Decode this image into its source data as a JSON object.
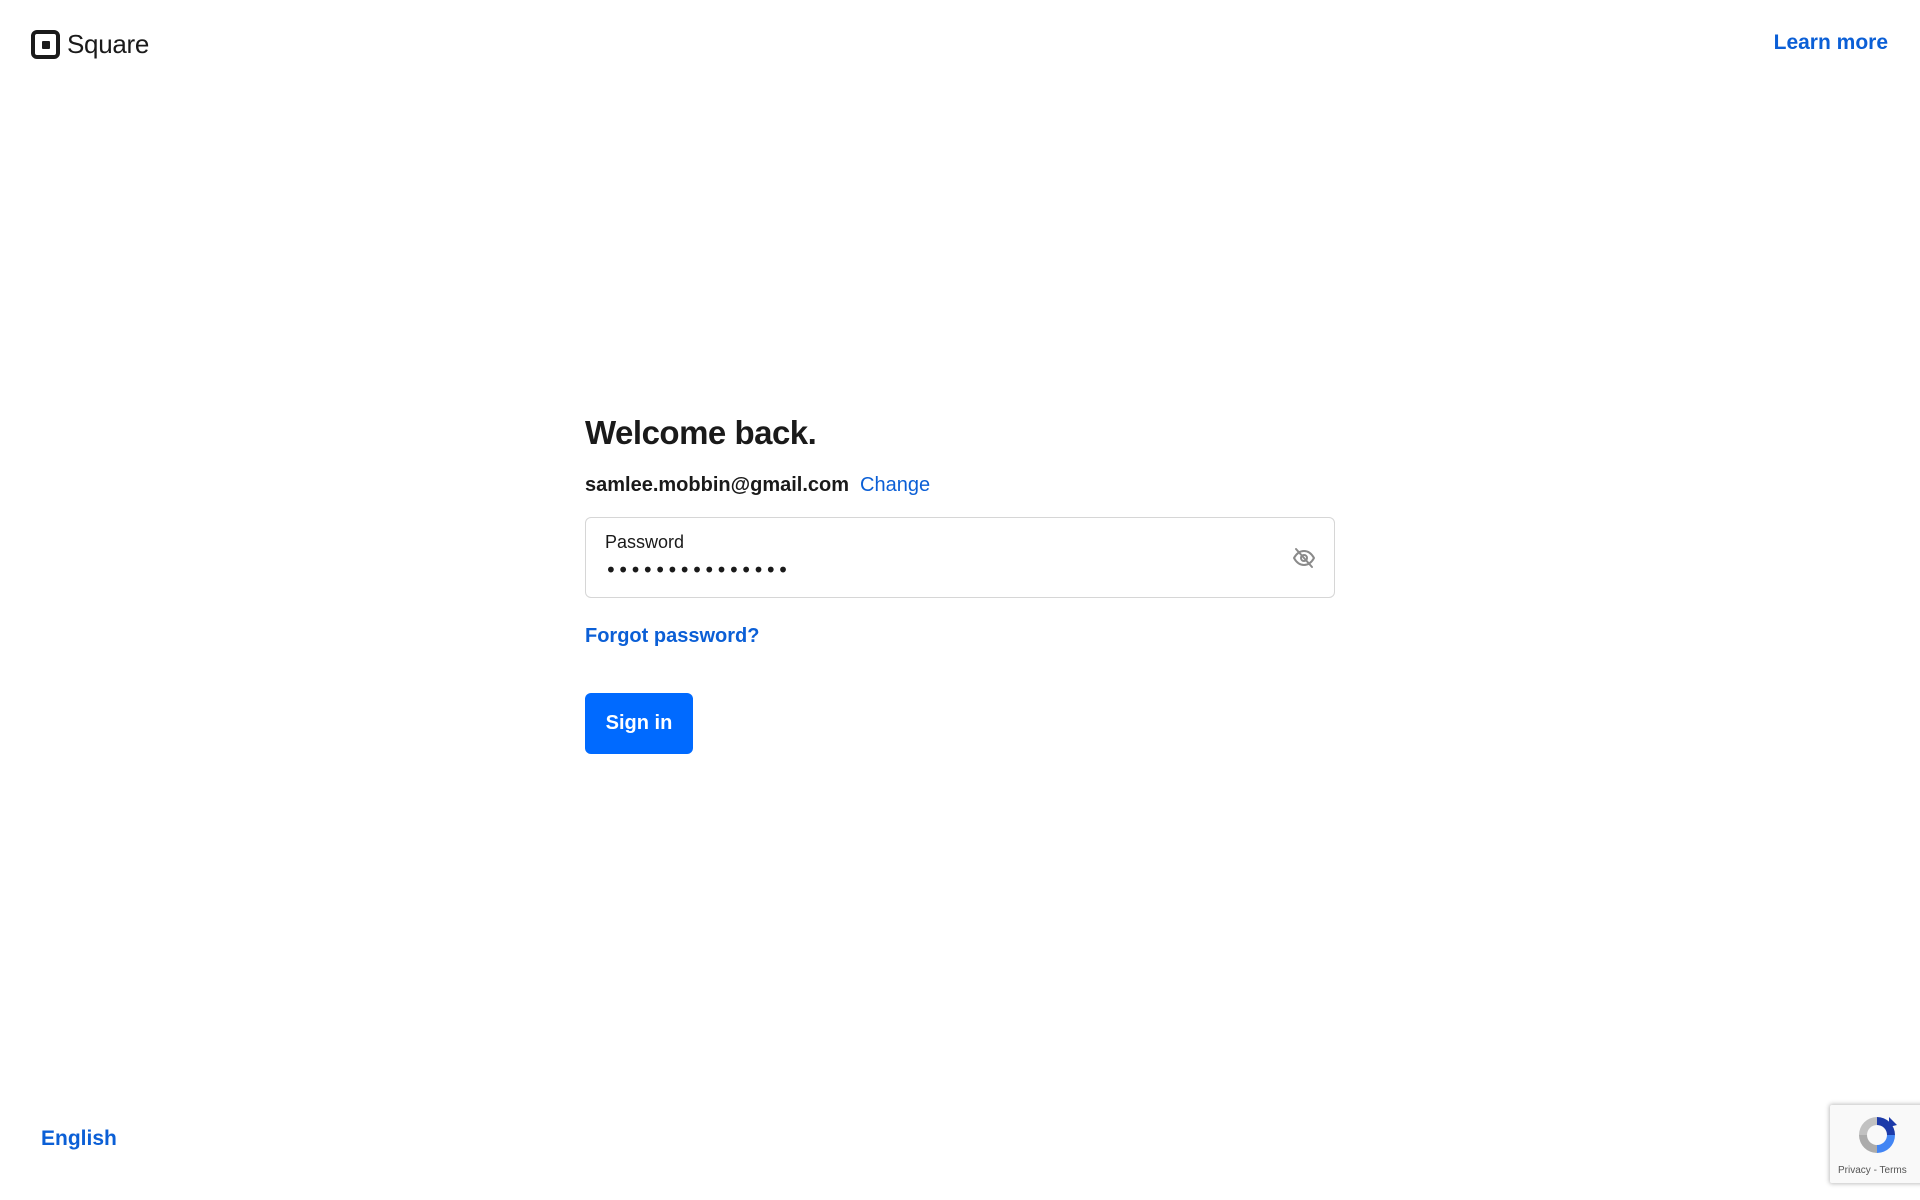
{
  "header": {
    "brand": "Square",
    "learn_more": "Learn more"
  },
  "form": {
    "title": "Welcome back.",
    "email": "samlee.mobbin@gmail.com",
    "change_label": "Change",
    "password_label": "Password",
    "password_value": "•••••••••••••••",
    "forgot_label": "Forgot password?",
    "signin_label": "Sign in"
  },
  "footer": {
    "language": "English"
  },
  "recaptcha": {
    "privacy": "Privacy",
    "separator": " - ",
    "terms": "Terms"
  },
  "colors": {
    "link": "#0b5fd6",
    "primary_button": "#006aff",
    "text": "#1a1a1a"
  },
  "icons": {
    "logo": "square-logo-icon",
    "password_toggle": "eye-off-icon",
    "recaptcha": "recaptcha-icon"
  }
}
